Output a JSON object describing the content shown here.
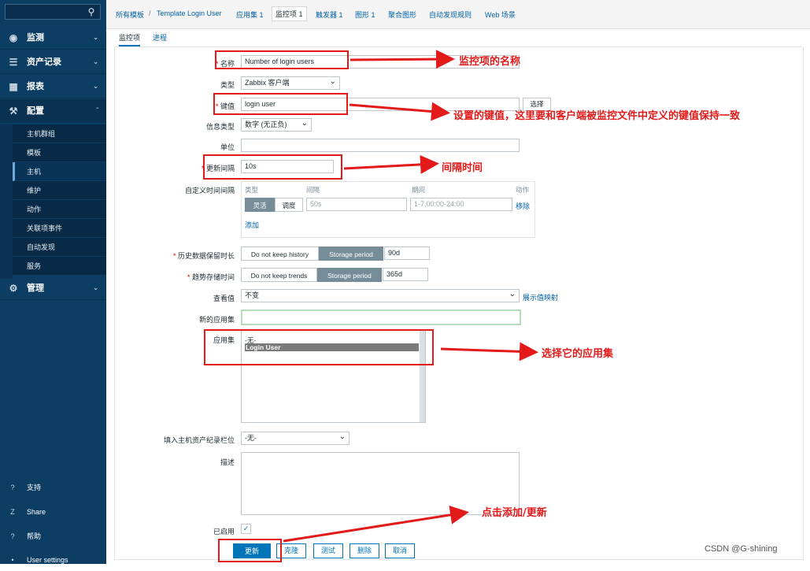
{
  "sidebar": {
    "search_icon": "search-icon",
    "menu": [
      {
        "label": "监测",
        "icon": "eye-icon"
      },
      {
        "label": "资产记录",
        "icon": "list-icon"
      },
      {
        "label": "报表",
        "icon": "bar-chart-icon"
      },
      {
        "label": "配置",
        "icon": "wrench-icon"
      }
    ],
    "sub_items": [
      "主机群组",
      "模板",
      "主机",
      "维护",
      "动作",
      "关联项事件",
      "自动发现",
      "服务"
    ],
    "admin": {
      "label": "管理",
      "icon": "gear-icon"
    },
    "bottom": [
      {
        "label": "支持",
        "icon": "support-icon",
        "glyph": "?"
      },
      {
        "label": "Share",
        "icon": "share-icon",
        "glyph": "Z"
      },
      {
        "label": "帮助",
        "icon": "help-icon",
        "glyph": "?"
      },
      {
        "label": "User settings",
        "icon": "user-icon",
        "glyph": "•"
      }
    ]
  },
  "topnav": {
    "all_templates": "所有模板",
    "separator": "/",
    "template": "Template Login User",
    "apps": "应用集 1",
    "items": "监控项 1",
    "triggers": "触发器 1",
    "graphs": "图形 1",
    "screens": "聚合图形",
    "discovery": "自动发现规则",
    "web": "Web 场景"
  },
  "tabs": {
    "item": "监控项",
    "preprocessing": "进程"
  },
  "form": {
    "name_label": "名称",
    "name_value": "Number of login users",
    "type_label": "类型",
    "type_value": "Zabbix 客户端",
    "key_label": "键值",
    "key_value": "login user",
    "select_button": "选择",
    "info_type_label": "信息类型",
    "info_type_value": "数字 (无正负)",
    "units_label": "单位",
    "units_value": "",
    "interval_label": "更新间隔",
    "interval_value": "10s",
    "custom_interval_label": "自定义时间间隔",
    "custom_interval": {
      "col_type": "类型",
      "col_interval": "间隔",
      "col_period": "期间",
      "col_action": "动作",
      "flexible": "灵活",
      "scheduling": "调度",
      "interval_placeholder": "50s",
      "period_placeholder": "1-7,00:00-24:00",
      "remove": "移除",
      "add": "添加"
    },
    "history_label": "历史数据保留时长",
    "history_no_keep": "Do not keep history",
    "history_storage": "Storage period",
    "history_value": "90d",
    "trends_label": "趋势存储时间",
    "trends_no_keep": "Do not keep trends",
    "trends_storage": "Storage period",
    "trends_value": "365d",
    "valuemap_label": "查看值",
    "valuemap_value": "不变",
    "valuemap_link": "展示值映射",
    "new_app_label": "新的应用集",
    "apps_label": "应用集",
    "apps_options": [
      "-无-",
      "Login User"
    ],
    "inventory_label": "填入主机资产纪录栏位",
    "inventory_value": "-无-",
    "description_label": "描述",
    "enabled_label": "已启用",
    "buttons": {
      "update": "更新",
      "clone": "克隆",
      "test": "测试",
      "delete": "删除",
      "cancel": "取消"
    }
  },
  "annotations": {
    "name": "监控项的名称",
    "key": "设置的键值，这里要和客户端被监控文件中定义的键值保持一致",
    "interval": "间隔时间",
    "apps": "选择它的应用集",
    "submit": "点击添加/更新"
  },
  "watermark": "CSDN @G-shining",
  "colors": {
    "sidebar": "#0c3d63",
    "accent": "#0275b8",
    "annotation": "#e21a1a"
  }
}
